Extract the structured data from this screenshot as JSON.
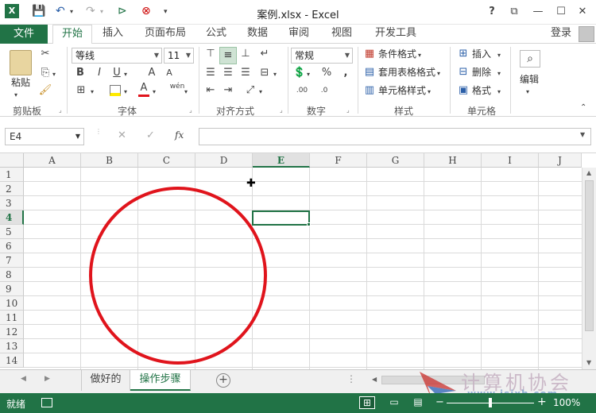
{
  "title_bar": {
    "title": "案例.xlsx - Excel",
    "buttons": {
      "help": "?",
      "restore": "⧉",
      "minimize": "—",
      "maximize": "☐",
      "close": "✕"
    }
  },
  "tabs": {
    "file": "文件",
    "items": [
      "开始",
      "插入",
      "页面布局",
      "公式",
      "数据",
      "审阅",
      "视图",
      "开发工具"
    ],
    "active": "开始",
    "login": "登录"
  },
  "ribbon": {
    "clipboard": {
      "label": "剪贴板",
      "paste": "粘贴"
    },
    "font": {
      "label": "字体",
      "font_name": "等线",
      "font_size": "11",
      "bold": "B",
      "italic": "I",
      "underline": "U",
      "grow": "A",
      "shrink": "A",
      "font_color": "A",
      "phonetic": "wén"
    },
    "alignment": {
      "label": "对齐方式"
    },
    "number": {
      "label": "数字",
      "format": "常规",
      "percent": "%",
      "comma": ",",
      "inc_decimal": ".00",
      "dec_decimal": ".0"
    },
    "styles": {
      "label": "样式",
      "conditional": "条件格式",
      "table": "套用表格格式",
      "cell_styles": "单元格样式"
    },
    "cells": {
      "label": "单元格",
      "insert": "插入",
      "delete": "删除",
      "format": "格式"
    },
    "editing": {
      "label": "编辑"
    }
  },
  "formula_bar": {
    "name_box": "E4",
    "cancel": "✕",
    "enter": "✓",
    "fx": "fx",
    "formula": ""
  },
  "grid": {
    "columns": [
      "A",
      "B",
      "C",
      "D",
      "E",
      "F",
      "G",
      "H",
      "I",
      "J"
    ],
    "rows": [
      "1",
      "2",
      "3",
      "4",
      "5",
      "6",
      "7",
      "8",
      "9",
      "10",
      "11",
      "12",
      "13",
      "14"
    ],
    "selected_col": "E",
    "selected_row": "4",
    "annotation_color": "#e0141c"
  },
  "sheet_tabs": {
    "items": [
      "做好的",
      "操作步骤"
    ],
    "active": "操作步骤",
    "add": "+"
  },
  "status_bar": {
    "ready": "就绪",
    "zoom": "100%",
    "zoom_minus": "−",
    "zoom_plus": "+"
  },
  "watermark": {
    "text": "计算机协会",
    "url": "www.jsjxh.com"
  }
}
